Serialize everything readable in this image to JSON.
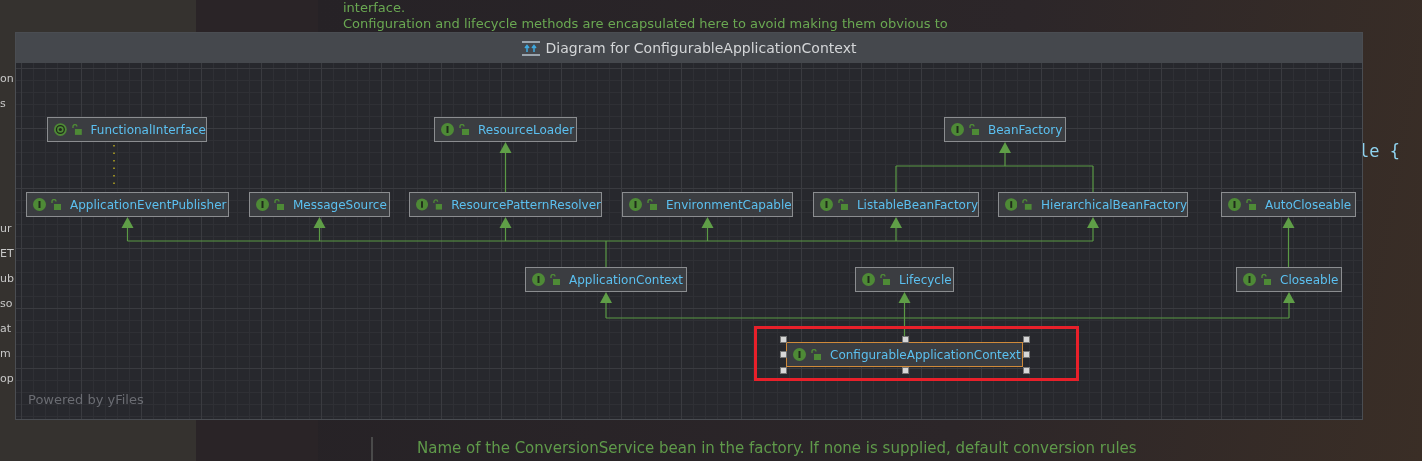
{
  "editor_background": {
    "left_panel_fragments": [
      "on",
      "s",
      "ur",
      "ET",
      "ub",
      "so",
      "at",
      "m",
      "op"
    ],
    "doc_lines": [
      "interface.",
      "Configuration and lifecycle methods are encapsulated here to avoid making them obvious to"
    ],
    "code_fragment": "le {",
    "bottom_doc_line": "Name of the ConversionService bean in the factory. If none is supplied, default conversion rules"
  },
  "diagram": {
    "title": "Diagram for ConfigurableApplicationContext",
    "nodes": [
      {
        "name": "FunctionalInterface",
        "kind": "annotation",
        "selected": false
      },
      {
        "name": "ResourceLoader",
        "kind": "interface",
        "selected": false
      },
      {
        "name": "BeanFactory",
        "kind": "interface",
        "selected": false
      },
      {
        "name": "ApplicationEventPublisher",
        "kind": "interface",
        "selected": false
      },
      {
        "name": "MessageSource",
        "kind": "interface",
        "selected": false
      },
      {
        "name": "ResourcePatternResolver",
        "kind": "interface",
        "selected": false
      },
      {
        "name": "EnvironmentCapable",
        "kind": "interface",
        "selected": false
      },
      {
        "name": "ListableBeanFactory",
        "kind": "interface",
        "selected": false
      },
      {
        "name": "HierarchicalBeanFactory",
        "kind": "interface",
        "selected": false
      },
      {
        "name": "AutoCloseable",
        "kind": "interface",
        "selected": false
      },
      {
        "name": "ApplicationContext",
        "kind": "interface",
        "selected": false
      },
      {
        "name": "Lifecycle",
        "kind": "interface",
        "selected": false
      },
      {
        "name": "Closeable",
        "kind": "interface",
        "selected": false
      },
      {
        "name": "ConfigurableApplicationContext",
        "kind": "interface",
        "selected": true
      }
    ],
    "watermark": "Powered by yFiles"
  }
}
